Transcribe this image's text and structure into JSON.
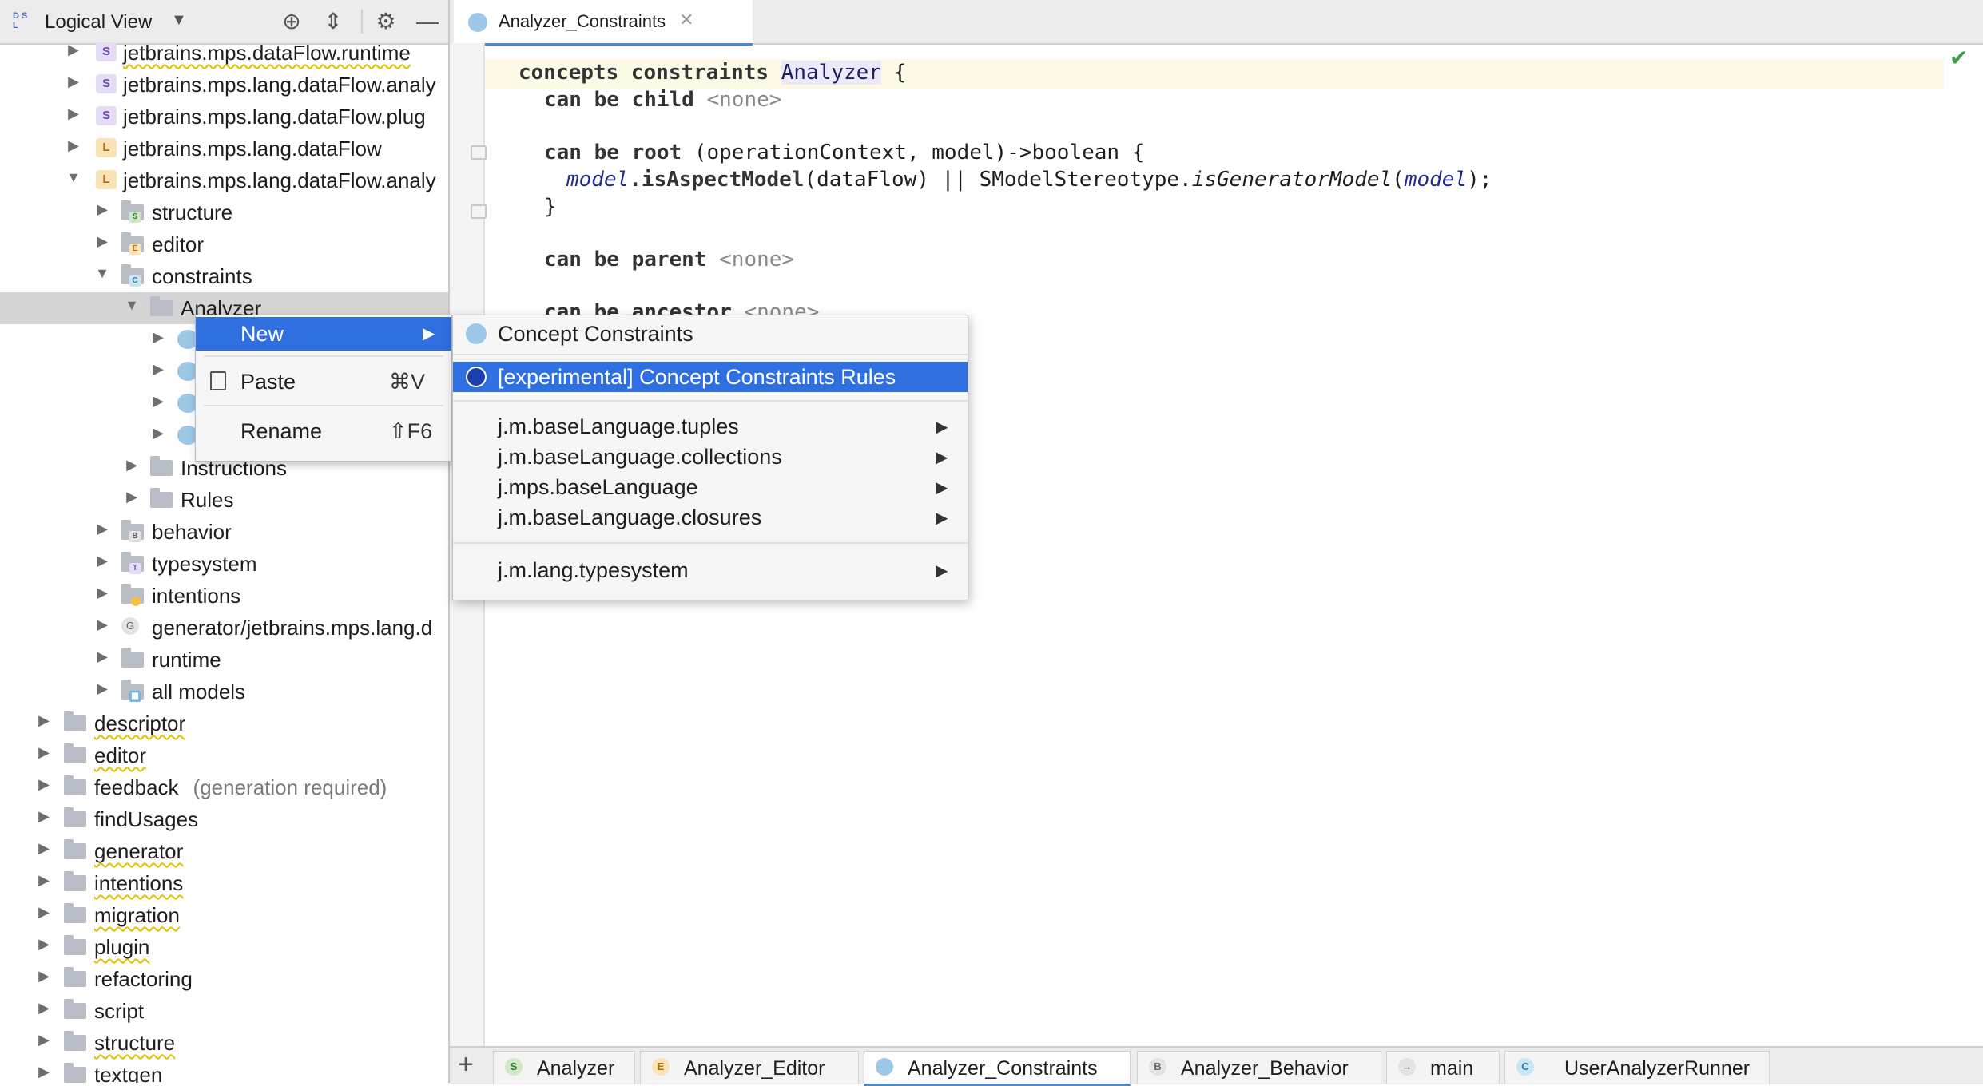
{
  "left_panel": {
    "title": "Logical View",
    "tree": [
      {
        "label": "jetbrains.mps.dataFlow.runtime",
        "icon": "solution-icon",
        "wavy": true
      },
      {
        "label": "jetbrains.mps.lang.dataFlow.analy",
        "icon": "solution-icon"
      },
      {
        "label": "jetbrains.mps.lang.dataFlow.plug",
        "icon": "solution-icon"
      },
      {
        "label": "jetbrains.mps.lang.dataFlow",
        "icon": "language-icon"
      },
      {
        "label": "jetbrains.mps.lang.dataFlow.analy",
        "icon": "language-icon"
      },
      {
        "label": "structure"
      },
      {
        "label": "editor"
      },
      {
        "label": "constraints"
      },
      {
        "label": "Analyzer"
      },
      {
        "label": "Instructions"
      },
      {
        "label": "Rules"
      },
      {
        "label": "behavior"
      },
      {
        "label": "typesystem"
      },
      {
        "label": "intentions"
      },
      {
        "label": "generator/jetbrains.mps.lang.d"
      },
      {
        "label": "runtime"
      },
      {
        "label": "all models"
      },
      {
        "label": "descriptor"
      },
      {
        "label": "editor"
      },
      {
        "label": "feedback",
        "note": "(generation required)"
      },
      {
        "label": "findUsages"
      },
      {
        "label": "generator"
      },
      {
        "label": "intentions"
      },
      {
        "label": "migration"
      },
      {
        "label": "plugin"
      },
      {
        "label": "refactoring"
      },
      {
        "label": "script"
      },
      {
        "label": "structure"
      },
      {
        "label": "textgen"
      }
    ]
  },
  "editor": {
    "tab_label": "Analyzer_Constraints",
    "code": {
      "l1_kw": "concepts constraints",
      "l1_ref": "Analyzer",
      "l1_brace": "{",
      "l2_kw": "can be child",
      "l2_none": "<none>",
      "l3_kw": "can be root",
      "l3_sig": "(operationContext, model)->boolean {",
      "l4_var1": "model",
      "l4_m1": ".isAspectModel",
      "l4_mid": "(dataFlow) || SModelStereotype.",
      "l4_m2": "isGeneratorModel",
      "l4_p": "(",
      "l4_var2": "model",
      "l4_end": ");",
      "l5": "}",
      "l6_kw": "can be parent",
      "l6_none": "<none>",
      "l7_kw": "can be ancestor",
      "l7_none": "<none>"
    }
  },
  "context_menu": {
    "new_label": "New",
    "paste_label": "Paste",
    "paste_shortcut": "⌘V",
    "rename_label": "Rename",
    "rename_shortcut": "⇧F6"
  },
  "submenu": {
    "items": [
      {
        "label": "Concept Constraints"
      },
      {
        "label": "[experimental] Concept Constraints Rules"
      },
      {
        "label": "j.m.baseLanguage.tuples"
      },
      {
        "label": "j.m.baseLanguage.collections"
      },
      {
        "label": "j.mps.baseLanguage"
      },
      {
        "label": "j.m.baseLanguage.closures"
      },
      {
        "label": "j.m.lang.typesystem"
      }
    ]
  },
  "bottom_tabs": [
    {
      "label": "Analyzer",
      "letter": "S"
    },
    {
      "label": "Analyzer_Editor",
      "letter": "E"
    },
    {
      "label": "Analyzer_Constraints",
      "letter": ""
    },
    {
      "label": "Analyzer_Behavior",
      "letter": "B"
    },
    {
      "label": "main",
      "letter": "→"
    },
    {
      "label": "UserAnalyzerRunner",
      "letter": "C"
    }
  ],
  "colors": {
    "selection": "#2f6fe0",
    "accent_tab": "#4a88d4",
    "ok_check": "#3aa34a"
  }
}
